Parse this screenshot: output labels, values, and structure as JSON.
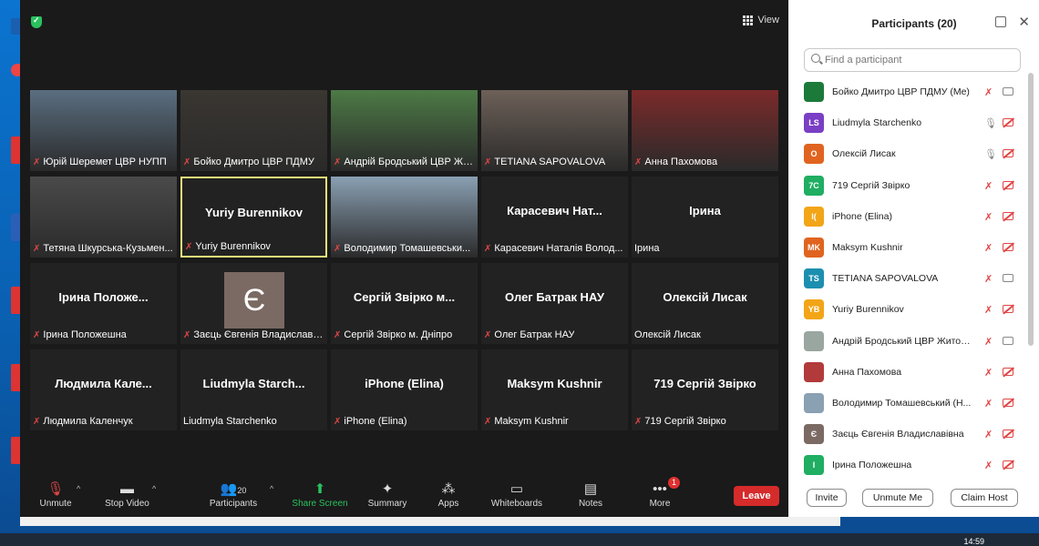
{
  "meeting": {
    "view_label": "View",
    "tiles": [
      {
        "label": "Юрій Шеремет ЦВР НУПП",
        "big": "",
        "muted": true,
        "photo": "#5a6e80"
      },
      {
        "label": "Бойко Дмитро ЦВР ПДМУ",
        "big": "",
        "muted": true,
        "photo": "#3a3631"
      },
      {
        "label": "Андрій Бродський ЦВР Жи...",
        "big": "",
        "muted": true,
        "photo": "#4c7a45"
      },
      {
        "label": "TETIANA SAPOVALOVA",
        "big": "",
        "muted": true,
        "photo": "#6d6058"
      },
      {
        "label": "Анна Пахомова",
        "big": "",
        "muted": true,
        "photo": "#7b2a2a"
      },
      {
        "label": "Тетяна Шкурська-Кузьмен...",
        "big": "",
        "muted": true,
        "photo": "#4a4a4a"
      },
      {
        "label": "Yuriy Burennikov",
        "big": "Yuriy Burennikov",
        "muted": true,
        "photo": ""
      },
      {
        "label": "Володимир Томашевськи...",
        "big": "",
        "muted": true,
        "photo": "#8aa0b3"
      },
      {
        "label": "Карасевич Наталія Волод...",
        "big": "Карасевич  Нат...",
        "muted": true,
        "photo": ""
      },
      {
        "label": "Ірина",
        "big": "Ірина",
        "muted": false,
        "photo": ""
      },
      {
        "label": "Ірина Положешна",
        "big": "Ірина  Положе...",
        "muted": true,
        "photo": ""
      },
      {
        "label": "Заєць Євгенія Владиславів...",
        "big": "",
        "muted": true,
        "photo": "",
        "avatar": "Є"
      },
      {
        "label": "Сергій Звірко м. Дніпро",
        "big": "Сергій Звірко м...",
        "muted": true,
        "photo": ""
      },
      {
        "label": "Олег Батрак НАУ",
        "big": "Олег Батрак НАУ",
        "muted": true,
        "photo": ""
      },
      {
        "label": "Олексій Лисак",
        "big": "Олексій Лисак",
        "muted": false,
        "photo": ""
      },
      {
        "label": "Людмила Каленчук",
        "big": "Людмила  Кале...",
        "muted": true,
        "photo": ""
      },
      {
        "label": "Liudmyla Starchenko",
        "big": "Liudmyla  Starch...",
        "muted": false,
        "photo": ""
      },
      {
        "label": "iPhone (Elina)",
        "big": "iPhone (Elina)",
        "muted": true,
        "photo": ""
      },
      {
        "label": "Maksym Kushnir",
        "big": "Maksym Kushnir",
        "muted": true,
        "photo": ""
      },
      {
        "label": "719 Сергій Звірко",
        "big": "719 Сергій Звірко",
        "muted": true,
        "photo": ""
      }
    ]
  },
  "toolbar": {
    "unmute": "Unmute",
    "stop_video": "Stop Video",
    "participants": "Participants",
    "participants_count": "20",
    "share_screen": "Share Screen",
    "summary": "Summary",
    "apps": "Apps",
    "whiteboards": "Whiteboards",
    "notes": "Notes",
    "more": "More",
    "more_badge": "1",
    "leave": "Leave"
  },
  "panel": {
    "title": "Participants (20)",
    "search_placeholder": "Find a participant",
    "participants": [
      {
        "name": "Бойко Дмитро ЦВР ПДМУ (Me)",
        "initials": "",
        "color": "#1b7a3a",
        "mic": "off",
        "cam": "on"
      },
      {
        "name": "Liudmyla Starchenko",
        "initials": "LS",
        "color": "#7a3fc4",
        "mic": "on",
        "cam": "off"
      },
      {
        "name": "Олексій Лисак",
        "initials": "О",
        "color": "#e0641f",
        "mic": "on",
        "cam": "off"
      },
      {
        "name": "719 Сергій Звірко",
        "initials": "7С",
        "color": "#1fae62",
        "mic": "off",
        "cam": "off"
      },
      {
        "name": "iPhone (Elina)",
        "initials": "I(",
        "color": "#f2a516",
        "mic": "off",
        "cam": "off"
      },
      {
        "name": "Maksym Kushnir",
        "initials": "MK",
        "color": "#e0641f",
        "mic": "off",
        "cam": "off"
      },
      {
        "name": "TETIANA SAPOVALOVA",
        "initials": "TS",
        "color": "#1c8fb0",
        "mic": "off",
        "cam": "on"
      },
      {
        "name": "Yuriy Burennikov",
        "initials": "YB",
        "color": "#f2a516",
        "mic": "off",
        "cam": "off"
      },
      {
        "name": "Андрій Бродський ЦВР Житом...",
        "initials": "",
        "color": "#9aa6a0",
        "mic": "off",
        "cam": "on"
      },
      {
        "name": "Анна Пахомова",
        "initials": "",
        "color": "#b23a3a",
        "mic": "off",
        "cam": "off"
      },
      {
        "name": "Володимир Томашевський (Н...",
        "initials": "",
        "color": "#8aa0b3",
        "mic": "off",
        "cam": "off"
      },
      {
        "name": "Заєць Євгенія Владиславівна",
        "initials": "Є",
        "color": "#7a6a63",
        "mic": "off",
        "cam": "off"
      },
      {
        "name": "Ірина Положешна",
        "initials": "І",
        "color": "#1fae62",
        "mic": "off",
        "cam": "off"
      }
    ],
    "invite": "Invite",
    "unmute_me": "Unmute Me",
    "claim_host": "Claim Host"
  },
  "taskbar": {
    "time": "14:59"
  }
}
